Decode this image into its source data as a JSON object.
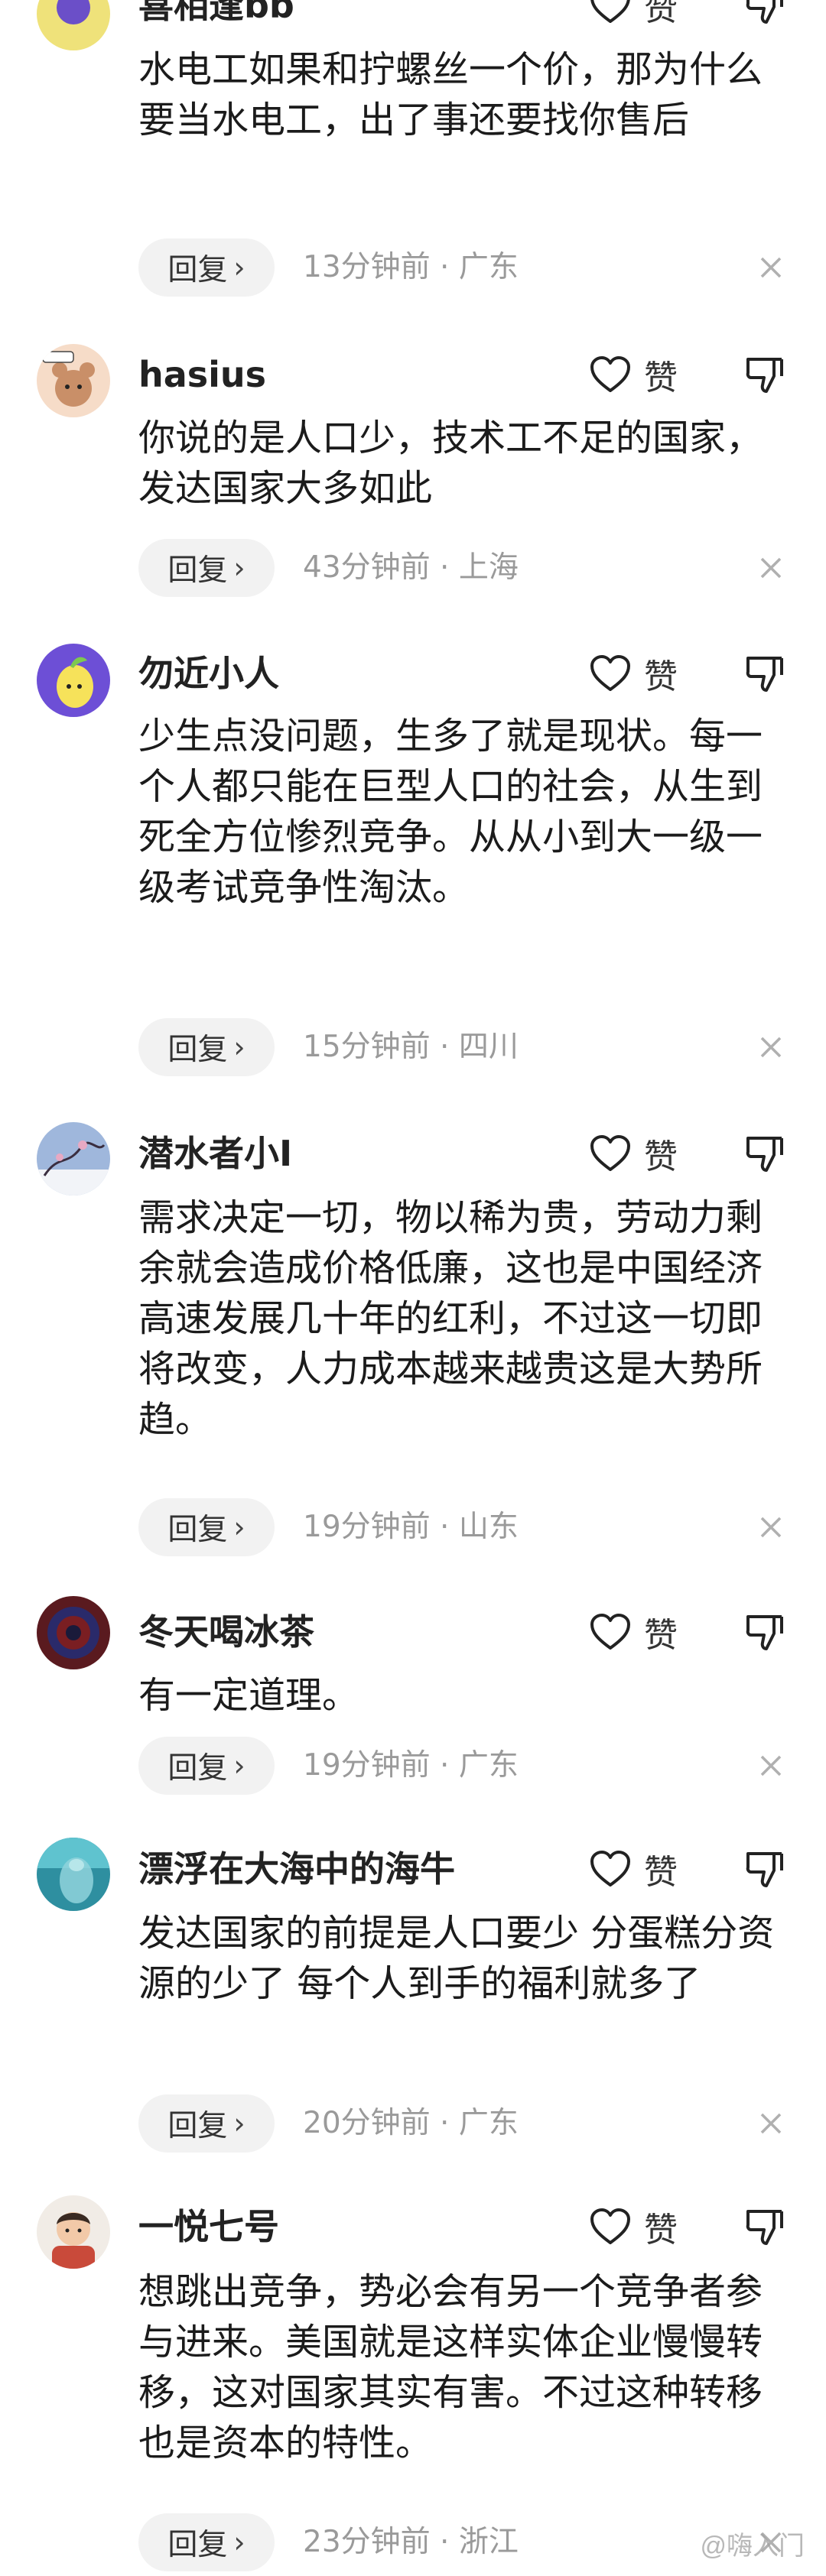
{
  "like_label": "赞",
  "reply_label": "回复",
  "reply_chevron": "›",
  "watermark": "@嗨入门",
  "comments": [
    {
      "username": "喜相逢bb",
      "text": "水电工如果和拧螺丝一个价，那为什么要当水电工，出了事还要找你售后",
      "time": "13分钟前",
      "location": "广东",
      "avatar_color": "#efe27a"
    },
    {
      "username": "hasius",
      "text": "你说的是人口少，技术工不足的国家，发达国家大多如此",
      "time": "43分钟前",
      "location": "上海",
      "avatar_color": "#f6dcc8"
    },
    {
      "username": "勿近小人",
      "text": "少生点没问题，生多了就是现状。每一个人都只能在巨型人口的社会，从生到死全方位惨烈竞争。从从小到大一级一级考试竞争性淘汰。",
      "time": "15分钟前",
      "location": "四川",
      "avatar_color": "#6d4fd6"
    },
    {
      "username": "潜水者小I",
      "text": "需求决定一切，物以稀为贵，劳动力剩余就会造成价格低廉，这也是中国经济高速发展几十年的红利，不过这一切即将改变，人力成本越来越贵这是大势所趋。",
      "time": "19分钟前",
      "location": "山东",
      "avatar_color": "#9fb7dc"
    },
    {
      "username": "冬天喝冰茶",
      "text": "有一定道理。",
      "time": "19分钟前",
      "location": "广东",
      "avatar_color": "#5a1a1f"
    },
    {
      "username": "漂浮在大海中的海牛",
      "text": "发达国家的前提是人口要少 分蛋糕分资源的少了 每个人到手的福利就多了",
      "time": "20分钟前",
      "location": "广东",
      "avatar_color": "#2e8fa0"
    },
    {
      "username": "一悦七号",
      "text": "想跳出竞争，势必会有另一个竞争者参与进来。美国就是这样实体企业慢慢转移，这对国家其实有害。不过这种转移也是资本的特性。",
      "time": "23分钟前",
      "location": "浙江",
      "avatar_color": "#c94a3a"
    }
  ]
}
